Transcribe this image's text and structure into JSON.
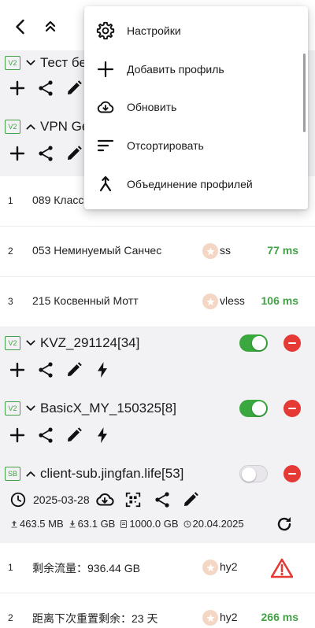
{
  "topbar": {
    "back_icon": "arrow-back-icon",
    "collapse_icon": "double-chevron-up-icon"
  },
  "menu": {
    "items": [
      {
        "label": "Настройки",
        "icon": "gear-icon"
      },
      {
        "label": "Добавить профиль",
        "icon": "plus-icon"
      },
      {
        "label": "Обновить",
        "icon": "cloud-download-icon"
      },
      {
        "label": "Отсортировать",
        "icon": "sort-icon"
      },
      {
        "label": "Объединение профилей",
        "icon": "merge-icon"
      }
    ]
  },
  "groups": [
    {
      "badge": "V2",
      "name": "Тест бе",
      "expanded": false
    },
    {
      "badge": "V2",
      "name": "VPN Ge",
      "expanded": true
    },
    {
      "badge": "V2",
      "name": "KVZ_291124[34]",
      "expanded": false,
      "enabled": true
    },
    {
      "badge": "V2",
      "name": "BasicX_MY_150325[8]",
      "expanded": false,
      "enabled": true
    },
    {
      "badge": "SB",
      "name": "client-sub.jingfan.life[53]",
      "expanded": true,
      "enabled": false
    }
  ],
  "vpn_rows": [
    {
      "index": "1",
      "name": "089 Класс",
      "type": "",
      "latency": ""
    },
    {
      "index": "2",
      "name": "053 Неминуемый Санчес",
      "type": "ss",
      "latency": "77 ms"
    },
    {
      "index": "3",
      "name": "215 Косвенный Мотт",
      "type": "vless",
      "latency": "106 ms"
    }
  ],
  "sub_info": {
    "date": "2025-03-28",
    "upload": "463.5 MB",
    "download": "63.1 GB",
    "total": "1000.0 GB",
    "expire": "20.04.2025"
  },
  "sub_rows": [
    {
      "index": "1",
      "name": "剩余流量：936.44 GB",
      "type": "hy2",
      "latency": ""
    },
    {
      "index": "2",
      "name": "距离下次重置剩余：23 天",
      "type": "hy2",
      "latency": "266 ms"
    }
  ],
  "colors": {
    "accent_green": "#43a047",
    "remove_red": "#e53935",
    "group_bg": "#f2f1f4"
  }
}
